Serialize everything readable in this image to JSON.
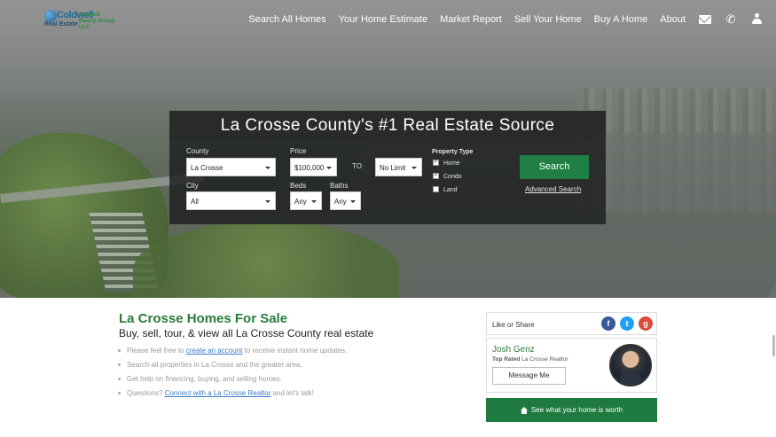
{
  "header": {
    "logo": {
      "brand_main": "Coldwell",
      "brand_sub": "Real Estate",
      "brand_group": "Summit Realty Group LLC"
    },
    "nav": [
      {
        "label": "Search All Homes"
      },
      {
        "label": "Your Home Estimate"
      },
      {
        "label": "Market Report"
      },
      {
        "label": "Sell Your Home"
      },
      {
        "label": "Buy A Home"
      },
      {
        "label": "About"
      }
    ],
    "icons": [
      "envelope-icon",
      "phone-icon",
      "user-icon"
    ]
  },
  "search": {
    "title": "La Crosse County's #1 Real Estate Source",
    "county_label": "County",
    "county_value": "La Crosse",
    "price_label": "Price",
    "price_min": "$100,000",
    "to_label": "TO",
    "price_max": "No Limit",
    "city_label": "City",
    "city_value": "All",
    "beds_label": "Beds",
    "beds_value": "Any",
    "baths_label": "Baths",
    "baths_value": "Any",
    "property_type_label": "Property Type",
    "property_types": [
      {
        "label": "Home",
        "checked": true
      },
      {
        "label": "Condo",
        "checked": true
      },
      {
        "label": "Land",
        "checked": false
      }
    ],
    "search_button": "Search",
    "advanced_link": "Advanced Search"
  },
  "content": {
    "title": "La Crosse Homes For Sale",
    "subtitle": "Buy, sell, tour, & view all La Crosse County real estate",
    "bullets": [
      {
        "pre": "Please feel free to ",
        "link": "create an account",
        "post": " to receive instant home updates."
      },
      {
        "pre": "Search all properties in La Crosse and the greater area.",
        "link": "",
        "post": ""
      },
      {
        "pre": "Get help on financing, buying, and selling homes.",
        "link": "",
        "post": ""
      },
      {
        "pre": "Questions? ",
        "link": "Connect with a La Crosse Realtor",
        "post": " and let's talk!"
      }
    ]
  },
  "sidebar": {
    "share_label": "Like or Share",
    "social": [
      {
        "name": "facebook-icon",
        "glyph": "f",
        "color": "#3b5998"
      },
      {
        "name": "twitter-icon",
        "glyph": "t",
        "color": "#1da1f2"
      },
      {
        "name": "google-plus-icon",
        "glyph": "g",
        "color": "#dd4b39"
      }
    ],
    "agent_name": "Josh Genz",
    "agent_role_bold": "Top Rated",
    "agent_role_rest": " La Crosse Realtor",
    "message_button": "Message Me",
    "worth_button": "See what your home is worth"
  },
  "colors": {
    "accent_green": "#1f7f45",
    "heading_green": "#2a7a3a",
    "link_blue": "#3a7cc7"
  }
}
